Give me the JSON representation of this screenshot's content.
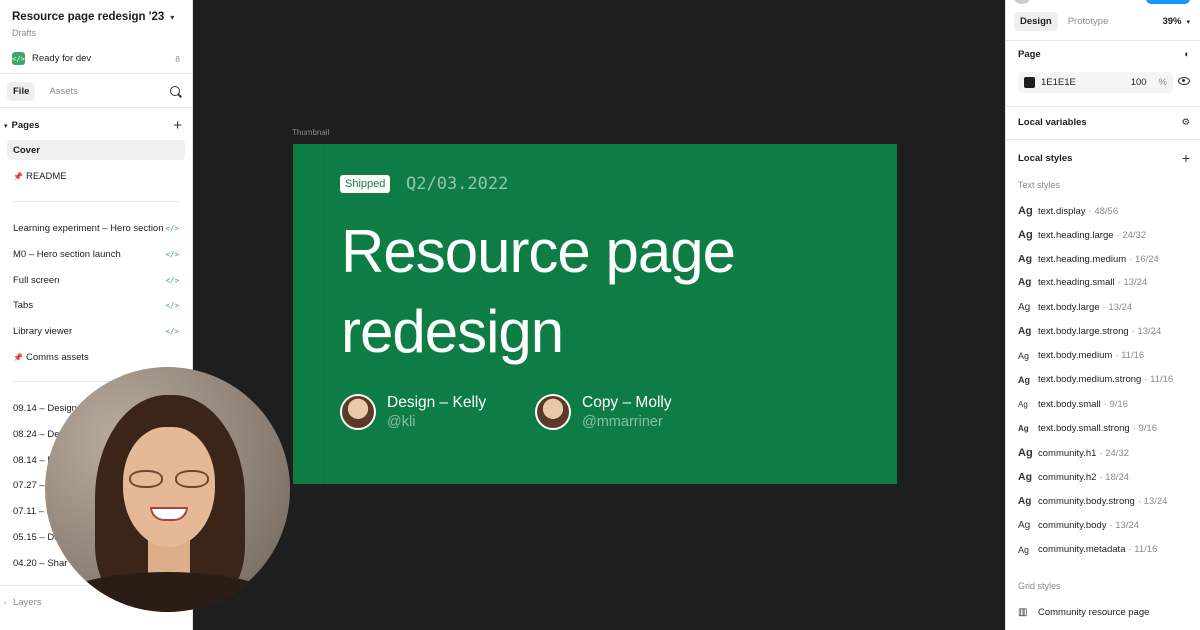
{
  "left_panel": {
    "file_title": "Resource page redesign '23",
    "file_location": "Drafts",
    "ready_for_dev": {
      "label": "Ready for dev",
      "count": "8",
      "icon": "code-icon"
    },
    "tabs": [
      "File",
      "Assets"
    ],
    "pages_header": "Pages",
    "pages": [
      {
        "label": "Cover",
        "selected": true
      },
      {
        "label": "README",
        "pinned": true
      }
    ],
    "dev_pages": [
      {
        "label": "Learning experiment – Hero section",
        "tag": "</>"
      },
      {
        "label": "M0 – Hero section launch",
        "tag": "</>"
      },
      {
        "label": "Full screen",
        "tag": "</>"
      },
      {
        "label": "Tabs",
        "tag": "</>"
      },
      {
        "label": "Library viewer",
        "tag": "</>"
      },
      {
        "label": "Comms assets",
        "pinned": true
      }
    ],
    "dated_pages": [
      "09.14 – Design",
      "08.24 – De",
      "08.14 – D",
      "07.27 –",
      "07.11 – D",
      "05.15 – De",
      "04.20 – Shar"
    ],
    "layers_label": "Layers"
  },
  "canvas": {
    "frame_label": "Thumbnail",
    "badge": "Shipped",
    "date": "Q2/03.2022",
    "title_line1": "Resource page",
    "title_line2": "redesign",
    "people": [
      {
        "name": "Design – Kelly",
        "handle": "@kli"
      },
      {
        "name": "Copy – Molly",
        "handle": "@mmarriner"
      }
    ],
    "frame_color": "#0e7d45"
  },
  "right_panel": {
    "tabs": [
      "Design",
      "Prototype"
    ],
    "zoom": "39%",
    "page_section": "Page",
    "page_fill": {
      "hex": "1E1E1E",
      "opacity": "100",
      "unit": "%",
      "color": "#1e1e1e"
    },
    "local_variables": "Local variables",
    "local_styles": "Local styles",
    "text_styles_label": "Text styles",
    "text_styles": [
      {
        "glyph": "Ag",
        "name": "text.display",
        "size": "· 48/56"
      },
      {
        "glyph": "Ag",
        "name": "text.heading.large",
        "size": "· 24/32"
      },
      {
        "glyph": "Ag",
        "name": "text.heading.medium",
        "size": "· 16/24"
      },
      {
        "glyph": "Ag",
        "name": "text.heading.small",
        "size": "· 13/24"
      },
      {
        "glyph": "Ag",
        "name": "text.body.large",
        "size": "· 13/24"
      },
      {
        "glyph": "Ag",
        "name": "text.body.large.strong",
        "size": "· 13/24"
      },
      {
        "glyph": "Ag",
        "name": "text.body.medium",
        "size": "· 11/16"
      },
      {
        "glyph": "Ag",
        "name": "text.body.medium.strong",
        "size": "· 11/16"
      },
      {
        "glyph": "Ag",
        "name": "text.body.small",
        "size": "· 9/16"
      },
      {
        "glyph": "Ag",
        "name": "text.body.small.strong",
        "size": "· 9/16"
      },
      {
        "glyph": "Ag",
        "name": "community.h1",
        "size": "· 24/32"
      },
      {
        "glyph": "Ag",
        "name": "community.h2",
        "size": "· 18/24"
      },
      {
        "glyph": "Ag",
        "name": "community.body.strong",
        "size": "· 13/24"
      },
      {
        "glyph": "Ag",
        "name": "community.body",
        "size": "· 13/24"
      },
      {
        "glyph": "Ag",
        "name": "community.metadata",
        "size": "· 11/16"
      }
    ],
    "grid_styles_label": "Grid styles",
    "grid_styles": [
      {
        "name": "Community resource page",
        "icon": "grid-icon"
      }
    ]
  },
  "accent_colors": {
    "figma_blue": "#0d99ff",
    "dev_green": "#3fa66b"
  }
}
